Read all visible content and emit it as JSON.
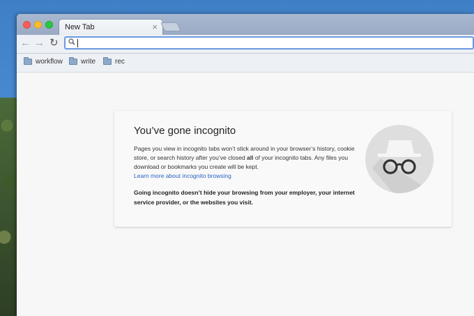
{
  "tab": {
    "title": "New Tab",
    "close": "×"
  },
  "toolbar": {
    "back": "←",
    "forward": "→",
    "reload": "↻",
    "omnibox_value": ""
  },
  "bookmarks": [
    {
      "label": "workflow"
    },
    {
      "label": "write"
    },
    {
      "label": "rec"
    }
  ],
  "incognito": {
    "heading": "You’ve gone incognito",
    "desc_part1": "Pages you view in incognito tabs won’t stick around in your browser’s history, cookie store, or search history after you’ve closed ",
    "desc_bold": "all",
    "desc_part2": " of your incognito tabs. Any files you download or bookmarks you create will be kept.",
    "learn_more": "Learn more about incognito browsing",
    "warning": "Going incognito doesn’t hide your browsing from your employer, your internet service provider, or the websites you visit."
  },
  "icons": {
    "tab_close": "close-icon",
    "search": "search-icon",
    "folder": "folder-icon",
    "incognito": "incognito-icon"
  },
  "colors": {
    "link": "#2a62c4",
    "omnibox_focus": "#6a9ae0",
    "traffic_close": "#fc5f57",
    "traffic_min": "#fdbc2e",
    "traffic_max": "#29c840"
  }
}
